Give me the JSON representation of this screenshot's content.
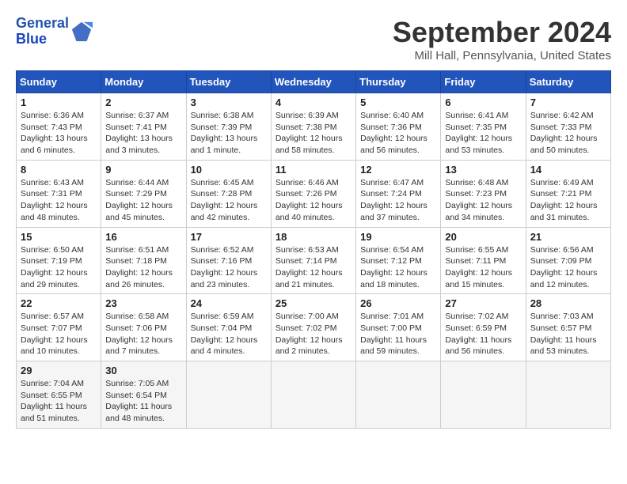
{
  "header": {
    "logo_line1": "General",
    "logo_line2": "Blue",
    "month_title": "September 2024",
    "location": "Mill Hall, Pennsylvania, United States"
  },
  "weekdays": [
    "Sunday",
    "Monday",
    "Tuesday",
    "Wednesday",
    "Thursday",
    "Friday",
    "Saturday"
  ],
  "weeks": [
    [
      {
        "day": "1",
        "sunrise": "6:36 AM",
        "sunset": "7:43 PM",
        "daylight": "13 hours and 6 minutes."
      },
      {
        "day": "2",
        "sunrise": "6:37 AM",
        "sunset": "7:41 PM",
        "daylight": "13 hours and 3 minutes."
      },
      {
        "day": "3",
        "sunrise": "6:38 AM",
        "sunset": "7:39 PM",
        "daylight": "13 hours and 1 minute."
      },
      {
        "day": "4",
        "sunrise": "6:39 AM",
        "sunset": "7:38 PM",
        "daylight": "12 hours and 58 minutes."
      },
      {
        "day": "5",
        "sunrise": "6:40 AM",
        "sunset": "7:36 PM",
        "daylight": "12 hours and 56 minutes."
      },
      {
        "day": "6",
        "sunrise": "6:41 AM",
        "sunset": "7:35 PM",
        "daylight": "12 hours and 53 minutes."
      },
      {
        "day": "7",
        "sunrise": "6:42 AM",
        "sunset": "7:33 PM",
        "daylight": "12 hours and 50 minutes."
      }
    ],
    [
      {
        "day": "8",
        "sunrise": "6:43 AM",
        "sunset": "7:31 PM",
        "daylight": "12 hours and 48 minutes."
      },
      {
        "day": "9",
        "sunrise": "6:44 AM",
        "sunset": "7:29 PM",
        "daylight": "12 hours and 45 minutes."
      },
      {
        "day": "10",
        "sunrise": "6:45 AM",
        "sunset": "7:28 PM",
        "daylight": "12 hours and 42 minutes."
      },
      {
        "day": "11",
        "sunrise": "6:46 AM",
        "sunset": "7:26 PM",
        "daylight": "12 hours and 40 minutes."
      },
      {
        "day": "12",
        "sunrise": "6:47 AM",
        "sunset": "7:24 PM",
        "daylight": "12 hours and 37 minutes."
      },
      {
        "day": "13",
        "sunrise": "6:48 AM",
        "sunset": "7:23 PM",
        "daylight": "12 hours and 34 minutes."
      },
      {
        "day": "14",
        "sunrise": "6:49 AM",
        "sunset": "7:21 PM",
        "daylight": "12 hours and 31 minutes."
      }
    ],
    [
      {
        "day": "15",
        "sunrise": "6:50 AM",
        "sunset": "7:19 PM",
        "daylight": "12 hours and 29 minutes."
      },
      {
        "day": "16",
        "sunrise": "6:51 AM",
        "sunset": "7:18 PM",
        "daylight": "12 hours and 26 minutes."
      },
      {
        "day": "17",
        "sunrise": "6:52 AM",
        "sunset": "7:16 PM",
        "daylight": "12 hours and 23 minutes."
      },
      {
        "day": "18",
        "sunrise": "6:53 AM",
        "sunset": "7:14 PM",
        "daylight": "12 hours and 21 minutes."
      },
      {
        "day": "19",
        "sunrise": "6:54 AM",
        "sunset": "7:12 PM",
        "daylight": "12 hours and 18 minutes."
      },
      {
        "day": "20",
        "sunrise": "6:55 AM",
        "sunset": "7:11 PM",
        "daylight": "12 hours and 15 minutes."
      },
      {
        "day": "21",
        "sunrise": "6:56 AM",
        "sunset": "7:09 PM",
        "daylight": "12 hours and 12 minutes."
      }
    ],
    [
      {
        "day": "22",
        "sunrise": "6:57 AM",
        "sunset": "7:07 PM",
        "daylight": "12 hours and 10 minutes."
      },
      {
        "day": "23",
        "sunrise": "6:58 AM",
        "sunset": "7:06 PM",
        "daylight": "12 hours and 7 minutes."
      },
      {
        "day": "24",
        "sunrise": "6:59 AM",
        "sunset": "7:04 PM",
        "daylight": "12 hours and 4 minutes."
      },
      {
        "day": "25",
        "sunrise": "7:00 AM",
        "sunset": "7:02 PM",
        "daylight": "12 hours and 2 minutes."
      },
      {
        "day": "26",
        "sunrise": "7:01 AM",
        "sunset": "7:00 PM",
        "daylight": "11 hours and 59 minutes."
      },
      {
        "day": "27",
        "sunrise": "7:02 AM",
        "sunset": "6:59 PM",
        "daylight": "11 hours and 56 minutes."
      },
      {
        "day": "28",
        "sunrise": "7:03 AM",
        "sunset": "6:57 PM",
        "daylight": "11 hours and 53 minutes."
      }
    ],
    [
      {
        "day": "29",
        "sunrise": "7:04 AM",
        "sunset": "6:55 PM",
        "daylight": "11 hours and 51 minutes."
      },
      {
        "day": "30",
        "sunrise": "7:05 AM",
        "sunset": "6:54 PM",
        "daylight": "11 hours and 48 minutes."
      },
      null,
      null,
      null,
      null,
      null
    ]
  ]
}
